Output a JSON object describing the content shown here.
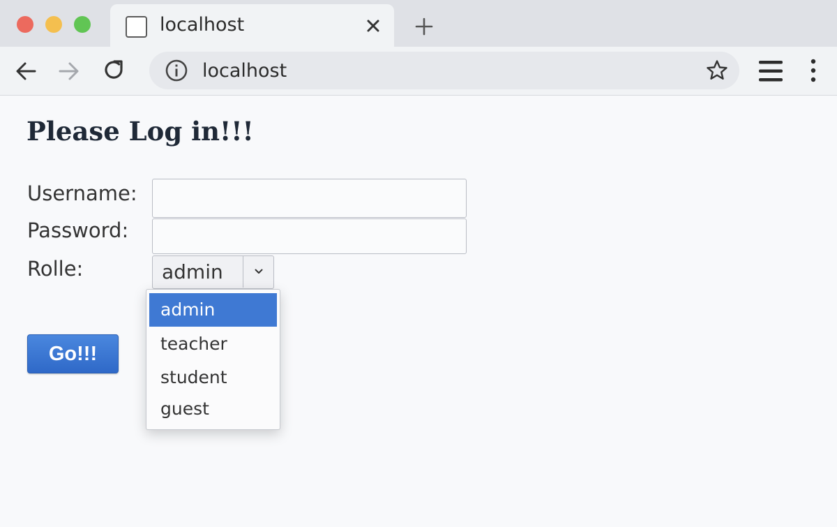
{
  "browser": {
    "tab": {
      "title": "localhost"
    },
    "address_bar": {
      "url": "localhost"
    }
  },
  "icons": {
    "back": "back-arrow-icon",
    "forward": "forward-arrow-icon",
    "reload": "reload-icon",
    "info": "info-icon",
    "bookmark": "star-icon",
    "menu": "hamburger-menu-icon",
    "more": "kebab-menu-icon",
    "close": "close-icon",
    "new_tab": "plus-icon",
    "dropdown": "chevron-down-icon"
  },
  "page": {
    "title": "Please Log in!!!",
    "form": {
      "username_label": "Username:",
      "username_value": "",
      "password_label": "Password:",
      "password_value": "",
      "role_label": "Rolle:",
      "role_selected": "admin",
      "role_options": [
        "admin",
        "teacher",
        "student",
        "guest"
      ],
      "submit_label": "Go!!!"
    }
  },
  "colors": {
    "accent": "#3f79d3",
    "button": "#3a77d6",
    "traffic_red": "#ec6a5e",
    "traffic_yellow": "#f4bf4f",
    "traffic_green": "#61c554"
  }
}
